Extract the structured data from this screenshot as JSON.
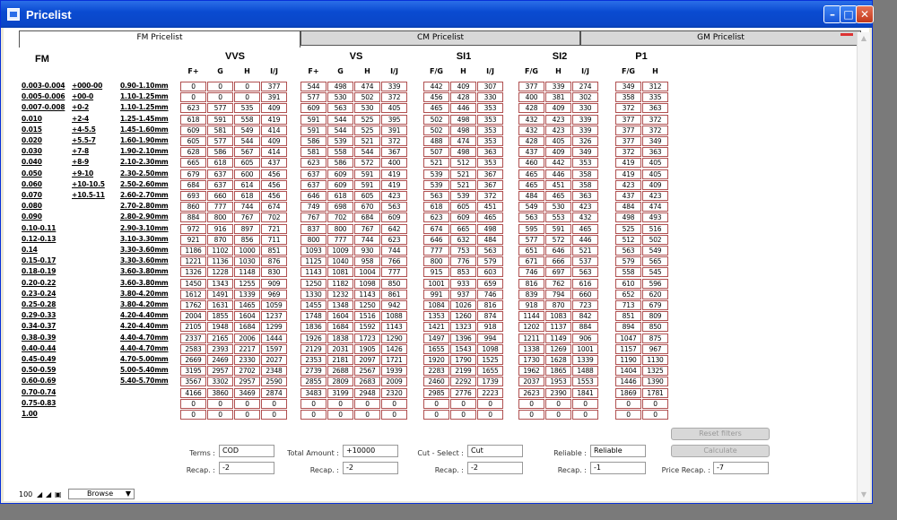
{
  "window": {
    "title": "Pricelist"
  },
  "tabs": [
    {
      "label": "FM Pricelist",
      "active": true
    },
    {
      "label": "CM Pricelist",
      "active": false
    },
    {
      "label": "GM Pricelist",
      "active": false
    }
  ],
  "fm_header": "FM",
  "groups": [
    {
      "name": "VVS",
      "cols": [
        "F+",
        "G",
        "H",
        "I/J"
      ]
    },
    {
      "name": "VS",
      "cols": [
        "F+",
        "G",
        "H",
        "I/J"
      ]
    },
    {
      "name": "SI1",
      "cols": [
        "F/G",
        "H",
        "I/J"
      ]
    },
    {
      "name": "SI2",
      "cols": [
        "F/G",
        "H",
        "I/J"
      ]
    },
    {
      "name": "P1",
      "cols": [
        "F/G",
        "H"
      ]
    }
  ],
  "row_labels": {
    "carat": [
      "0.003-0.004",
      "0.005-0.006",
      "0.007-0.008",
      "0.010",
      "0.015",
      "0.020",
      "0.030",
      "0.040",
      "0.050",
      "0.060",
      "0.070",
      "0.080",
      "0.090",
      "0.10-0.11",
      "0.12-0.13",
      "0.14",
      "0.15-0.17",
      "0.18-0.19",
      "0.20-0.22",
      "0.23-0.24",
      "0.25-0.28",
      "0.29-0.33",
      "0.34-0.37",
      "0.38-0.39",
      "0.40-0.44",
      "0.45-0.49",
      "0.50-0.59",
      "0.60-0.69",
      "0.70-0.74",
      "0.75-0.83",
      "1.00"
    ],
    "sieve": [
      "+000-00",
      "+00-0",
      "+0-2",
      "+2-4",
      "+4-5.5",
      "+5.5-7",
      "+7-8",
      "+8-9",
      "+9-10",
      "+10-10.5",
      "+10.5-11"
    ],
    "mm": [
      "0.90-1.10mm",
      "1.10-1.25mm",
      "1.10-1.25mm",
      "1.25-1.45mm",
      "1.45-1.60mm",
      "1.60-1.90mm",
      "1.90-2.10mm",
      "2.10-2.30mm",
      "2.30-2.50mm",
      "2.50-2.60mm",
      "2.60-2.70mm",
      "2.70-2.80mm",
      "2.80-2.90mm",
      "2.90-3.10mm",
      "3.10-3.30mm",
      "3.30-3.60mm",
      "3.30-3.60mm",
      "3.60-3.80mm",
      "3.60-3.80mm",
      "3.80-4.20mm",
      "3.80-4.20mm",
      "4.20-4.40mm",
      "4.20-4.40mm",
      "4.40-4.70mm",
      "4.40-4.70mm",
      "4.70-5.00mm",
      "5.00-5.40mm",
      "5.40-5.70mm"
    ]
  },
  "rows": [
    [
      "0",
      "0",
      "0",
      "377",
      "544",
      "498",
      "474",
      "339",
      "442",
      "409",
      "307",
      "377",
      "339",
      "274",
      "349",
      "312"
    ],
    [
      "0",
      "0",
      "0",
      "391",
      "577",
      "530",
      "502",
      "372",
      "456",
      "428",
      "330",
      "400",
      "381",
      "302",
      "358",
      "335"
    ],
    [
      "623",
      "577",
      "535",
      "409",
      "609",
      "563",
      "530",
      "405",
      "465",
      "446",
      "353",
      "428",
      "409",
      "330",
      "372",
      "363"
    ],
    [
      "618",
      "591",
      "558",
      "419",
      "591",
      "544",
      "525",
      "395",
      "502",
      "498",
      "353",
      "432",
      "423",
      "339",
      "377",
      "372"
    ],
    [
      "609",
      "581",
      "549",
      "414",
      "591",
      "544",
      "525",
      "391",
      "502",
      "498",
      "353",
      "432",
      "423",
      "339",
      "377",
      "372"
    ],
    [
      "605",
      "577",
      "544",
      "409",
      "586",
      "539",
      "521",
      "372",
      "488",
      "474",
      "353",
      "428",
      "405",
      "326",
      "377",
      "349"
    ],
    [
      "628",
      "586",
      "567",
      "414",
      "581",
      "558",
      "544",
      "367",
      "507",
      "498",
      "363",
      "437",
      "409",
      "349",
      "372",
      "363"
    ],
    [
      "665",
      "618",
      "605",
      "437",
      "623",
      "586",
      "572",
      "400",
      "521",
      "512",
      "353",
      "460",
      "442",
      "353",
      "419",
      "405"
    ],
    [
      "679",
      "637",
      "600",
      "456",
      "637",
      "609",
      "591",
      "419",
      "539",
      "521",
      "367",
      "465",
      "446",
      "358",
      "419",
      "405"
    ],
    [
      "684",
      "637",
      "614",
      "456",
      "637",
      "609",
      "591",
      "419",
      "539",
      "521",
      "367",
      "465",
      "451",
      "358",
      "423",
      "409"
    ],
    [
      "693",
      "660",
      "618",
      "456",
      "646",
      "618",
      "605",
      "423",
      "563",
      "539",
      "372",
      "484",
      "465",
      "363",
      "437",
      "423"
    ],
    [
      "860",
      "777",
      "744",
      "674",
      "749",
      "698",
      "670",
      "563",
      "618",
      "605",
      "451",
      "549",
      "530",
      "423",
      "484",
      "474"
    ],
    [
      "884",
      "800",
      "767",
      "702",
      "767",
      "702",
      "684",
      "609",
      "623",
      "609",
      "465",
      "563",
      "553",
      "432",
      "498",
      "493"
    ],
    [
      "972",
      "916",
      "897",
      "721",
      "837",
      "800",
      "767",
      "642",
      "674",
      "665",
      "498",
      "595",
      "591",
      "465",
      "525",
      "516"
    ],
    [
      "921",
      "870",
      "856",
      "711",
      "800",
      "777",
      "744",
      "623",
      "646",
      "632",
      "484",
      "577",
      "572",
      "446",
      "512",
      "502"
    ],
    [
      "1186",
      "1102",
      "1000",
      "851",
      "1093",
      "1009",
      "930",
      "744",
      "777",
      "753",
      "563",
      "651",
      "646",
      "521",
      "563",
      "549"
    ],
    [
      "1221",
      "1136",
      "1030",
      "876",
      "1125",
      "1040",
      "958",
      "766",
      "800",
      "776",
      "579",
      "671",
      "666",
      "537",
      "579",
      "565"
    ],
    [
      "1326",
      "1228",
      "1148",
      "830",
      "1143",
      "1081",
      "1004",
      "777",
      "915",
      "853",
      "603",
      "746",
      "697",
      "563",
      "558",
      "545"
    ],
    [
      "1450",
      "1343",
      "1255",
      "909",
      "1250",
      "1182",
      "1098",
      "850",
      "1001",
      "933",
      "659",
      "816",
      "762",
      "616",
      "610",
      "596"
    ],
    [
      "1612",
      "1491",
      "1339",
      "969",
      "1330",
      "1232",
      "1143",
      "861",
      "991",
      "937",
      "746",
      "839",
      "794",
      "660",
      "652",
      "620"
    ],
    [
      "1762",
      "1631",
      "1465",
      "1059",
      "1455",
      "1348",
      "1250",
      "942",
      "1084",
      "1026",
      "816",
      "918",
      "870",
      "723",
      "713",
      "679"
    ],
    [
      "2004",
      "1855",
      "1604",
      "1237",
      "1748",
      "1604",
      "1516",
      "1088",
      "1353",
      "1260",
      "874",
      "1144",
      "1083",
      "842",
      "851",
      "809"
    ],
    [
      "2105",
      "1948",
      "1684",
      "1299",
      "1836",
      "1684",
      "1592",
      "1143",
      "1421",
      "1323",
      "918",
      "1202",
      "1137",
      "884",
      "894",
      "850"
    ],
    [
      "2337",
      "2165",
      "2006",
      "1444",
      "1926",
      "1838",
      "1723",
      "1290",
      "1497",
      "1396",
      "994",
      "1211",
      "1149",
      "906",
      "1047",
      "875"
    ],
    [
      "2583",
      "2393",
      "2217",
      "1597",
      "2129",
      "2031",
      "1905",
      "1426",
      "1655",
      "1543",
      "1098",
      "1338",
      "1269",
      "1001",
      "1157",
      "967"
    ],
    [
      "2669",
      "2469",
      "2330",
      "2027",
      "2353",
      "2181",
      "2097",
      "1721",
      "1920",
      "1790",
      "1525",
      "1730",
      "1628",
      "1339",
      "1190",
      "1130"
    ],
    [
      "3195",
      "2957",
      "2702",
      "2348",
      "2739",
      "2688",
      "2567",
      "1939",
      "2283",
      "2199",
      "1655",
      "1962",
      "1865",
      "1488",
      "1404",
      "1325"
    ],
    [
      "3567",
      "3302",
      "2957",
      "2590",
      "2855",
      "2809",
      "2683",
      "2009",
      "2460",
      "2292",
      "1739",
      "2037",
      "1953",
      "1553",
      "1446",
      "1390"
    ],
    [
      "4166",
      "3860",
      "3469",
      "2874",
      "3483",
      "3199",
      "2948",
      "2320",
      "2985",
      "2776",
      "2223",
      "2623",
      "2390",
      "1841",
      "1869",
      "1781"
    ],
    [
      "0",
      "0",
      "0",
      "0",
      "0",
      "0",
      "0",
      "0",
      "0",
      "0",
      "0",
      "0",
      "0",
      "0",
      "0",
      "0"
    ],
    [
      "0",
      "0",
      "0",
      "0",
      "0",
      "0",
      "0",
      "0",
      "0",
      "0",
      "0",
      "0",
      "0",
      "0",
      "0",
      "0"
    ]
  ],
  "bottom": {
    "terms": {
      "label": "Terms :",
      "value": "COD",
      "recap_label": "Recap. :",
      "recap": "-2"
    },
    "total": {
      "label": "Total Amount :",
      "value": "+10000",
      "recap_label": "Recap. :",
      "recap": "-2"
    },
    "cut": {
      "label": "Cut - Select :",
      "value": "Cut",
      "recap_label": "Recap. :",
      "recap": "-2"
    },
    "reliable": {
      "label": "Reliable :",
      "value": "Reliable",
      "recap_label": "Recap. :",
      "recap": "-1"
    },
    "price_recap": {
      "label": "Price Recap. :",
      "value": "-7"
    },
    "reset_button": "Reset filters",
    "calculate_button": "Calculate"
  },
  "status": {
    "zoom": "100",
    "mode": "Browse"
  }
}
